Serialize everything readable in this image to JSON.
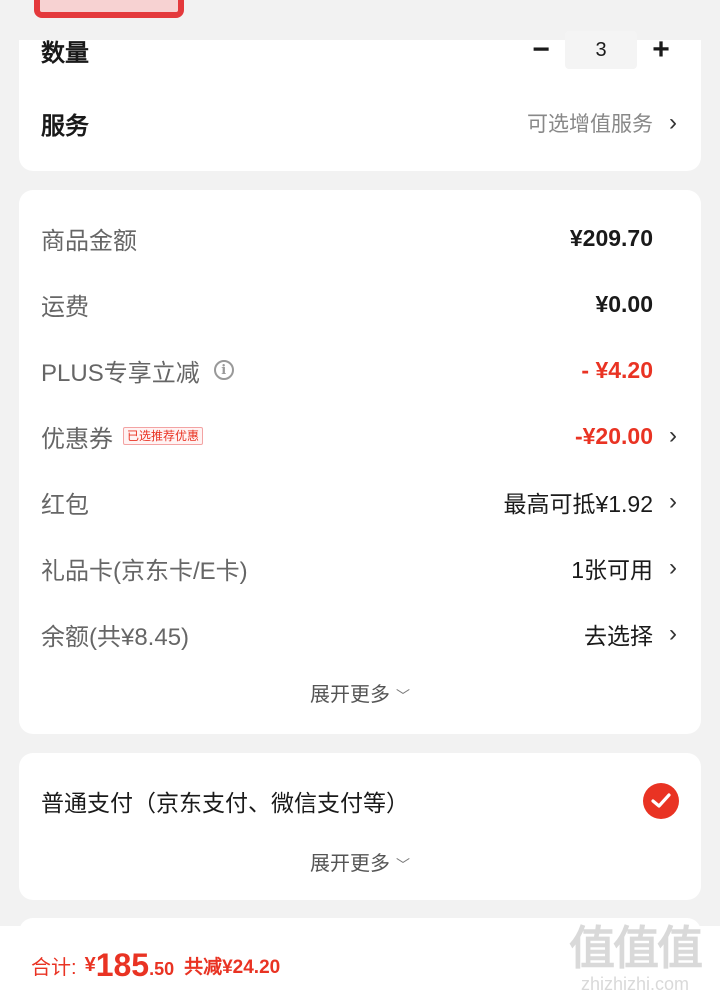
{
  "quantity_section": {
    "qty_label": "数量",
    "minus": "−",
    "qty_value": "3",
    "plus": "+",
    "service_label": "服务",
    "service_hint": "可选增值服务"
  },
  "price_section": {
    "goods_label": "商品金额",
    "goods_value": "¥209.70",
    "shipping_label": "运费",
    "shipping_value": "¥0.00",
    "plus_label": "PLUS专享立减",
    "plus_value": "- ¥4.20",
    "coupon_label": "优惠券",
    "coupon_tag": "已选推荐优惠",
    "coupon_value": "-¥20.00",
    "redpack_label": "红包",
    "redpack_value": "最高可抵¥1.92",
    "giftcard_label": "礼品卡(京东卡/E卡)",
    "giftcard_value": "1张可用",
    "balance_label": "余额(共¥8.45)",
    "balance_value": "去选择",
    "expand_more": "展开更多"
  },
  "payment_section": {
    "method_label": "普通支付（京东支付、微信支付等）",
    "expand_more": "展开更多"
  },
  "bottom_bar": {
    "total_label": "合计:",
    "currency": "¥",
    "total_integer": "185",
    "total_decimal": ".50",
    "total_saved": "共减¥24.20"
  },
  "watermark": {
    "chars": "值值值",
    "url": "zhizhizhi.com"
  },
  "colors": {
    "accent_red": "#e93323",
    "background": "#f2f2f2",
    "card": "#ffffff"
  },
  "icons": [
    "chevron-right-icon",
    "info-icon",
    "check-circle-icon",
    "chevron-down-icon"
  ]
}
